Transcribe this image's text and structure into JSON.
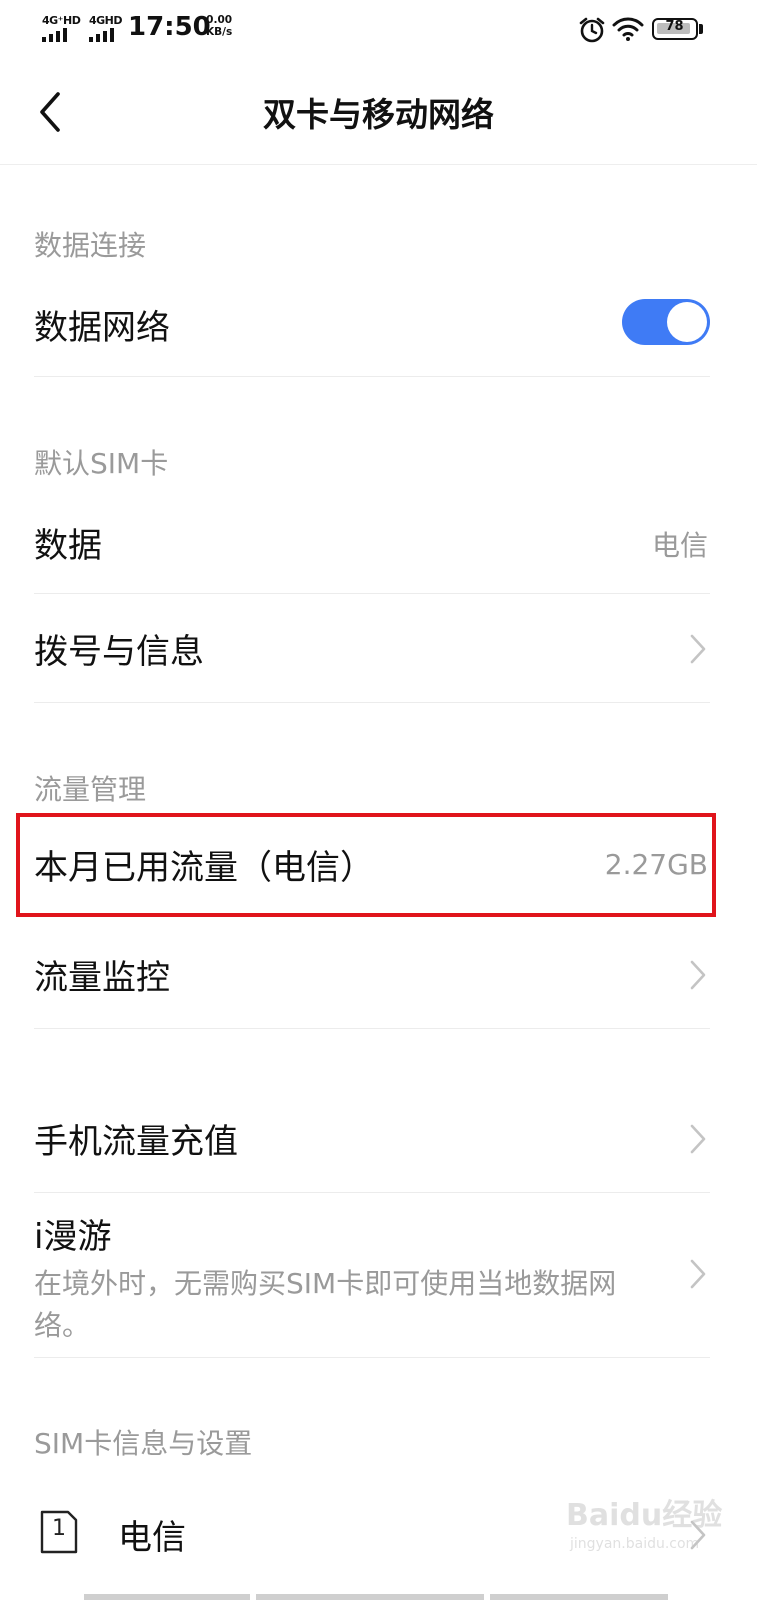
{
  "status_bar": {
    "sim1_label": "4G⁺HD",
    "sim2_label": "4GHD",
    "time": "17:50",
    "net_speed_value": "0.00",
    "net_speed_unit": "KB/s",
    "battery": "78",
    "icons": [
      "alarm-icon",
      "wifi-icon",
      "battery-icon"
    ]
  },
  "header": {
    "title": "双卡与移动网络"
  },
  "sections": {
    "data_connection": {
      "title": "数据连接",
      "data_network_label": "数据网络",
      "data_network_on": true
    },
    "default_sim": {
      "title": "默认SIM卡",
      "data_label": "数据",
      "data_value": "电信",
      "dial_label": "拨号与信息"
    },
    "traffic": {
      "title": "流量管理",
      "monthly_label": "本月已用流量（电信）",
      "monthly_value": "2.27GB",
      "monitor_label": "流量监控"
    },
    "extra": {
      "recharge_label": "手机流量充值",
      "roaming_label": "i漫游",
      "roaming_desc": "在境外时，无需购买SIM卡即可使用当地数据网络。"
    },
    "sim_info": {
      "title": "SIM卡信息与设置",
      "sim1_number": "1",
      "sim1_label": "电信"
    }
  },
  "watermark": {
    "text": "Baidu经验",
    "sub": "jingyan.baidu.com"
  },
  "colors": {
    "accent": "#3f7bf5",
    "highlight": "#e0141b",
    "secondary_text": "#9a9a9a"
  }
}
